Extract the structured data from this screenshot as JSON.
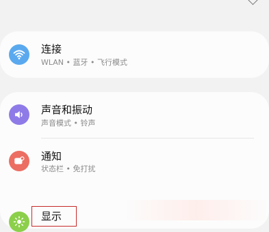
{
  "connections": {
    "title": "连接",
    "subtitle": "WLAN • 蓝牙 • 飞行模式",
    "icon": "wifi-icon",
    "color": "#5aa9ef"
  },
  "sound": {
    "title": "声音和振动",
    "subtitle": "声音模式 • 铃声",
    "icon": "speaker-icon",
    "color": "#8f7be8"
  },
  "notifications": {
    "title": "通知",
    "subtitle": "状态栏 • 免打扰",
    "icon": "notification-icon",
    "color": "#ec6d62"
  },
  "display": {
    "title": "显示",
    "icon": "brightness-icon",
    "color": "#8ccf4a"
  }
}
